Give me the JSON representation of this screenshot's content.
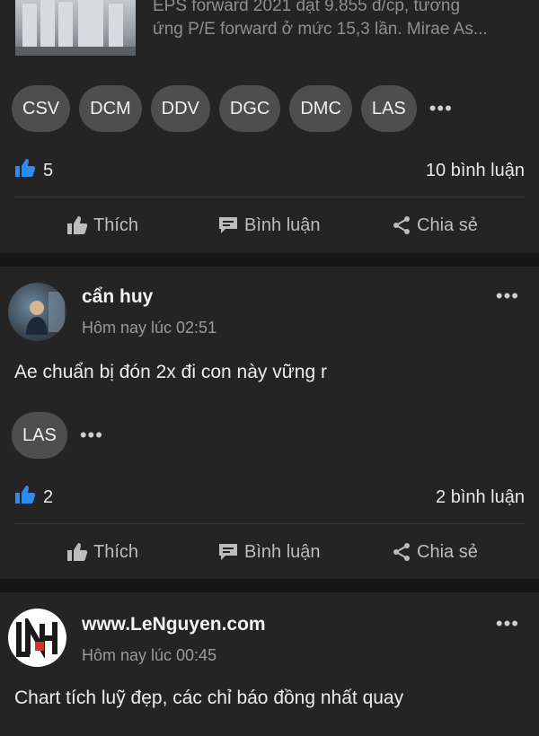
{
  "posts": [
    {
      "preview_lines": [
        "EPS forward 2021 đạt 9.855 đ/cp, tương",
        "ứng P/E forward ở mức 15,3 lần. Mirae As..."
      ],
      "tags": [
        "CSV",
        "DCM",
        "DDV",
        "DGC",
        "DMC",
        "LAS"
      ],
      "likes": "5",
      "comments": "10 bình luận"
    },
    {
      "author": "cẩn huy",
      "time": "Hôm nay lúc 02:51",
      "body": "Ae chuẩn bị đón 2x đi con này vững r",
      "tags": [
        "LAS"
      ],
      "likes": "2",
      "comments": "2 bình luận"
    },
    {
      "author": "www.LeNguyen.com",
      "time": "Hôm nay lúc 00:45",
      "body": "Chart tích luỹ đẹp, các chỉ báo đồng nhất quay"
    }
  ],
  "actions": {
    "like": "Thích",
    "comment": "Bình luận",
    "share": "Chia sẻ"
  },
  "colors": {
    "accent": "#2f8bf0",
    "card": "#242424",
    "background": "#171717",
    "tag": "#4e4e4e"
  }
}
